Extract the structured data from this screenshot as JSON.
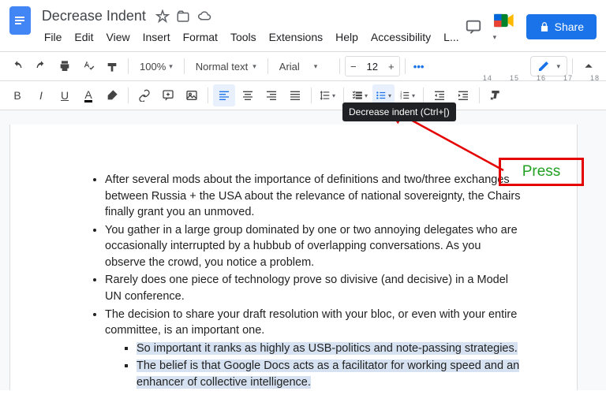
{
  "doc_title": "Decrease Indent",
  "menus": [
    "File",
    "Edit",
    "View",
    "Insert",
    "Format",
    "Tools",
    "Extensions",
    "Help",
    "Accessibility",
    "L..."
  ],
  "share_label": "Share",
  "toolbar": {
    "zoom": "100%",
    "style": "Normal text",
    "font": "Arial",
    "font_size": "12"
  },
  "tooltip": "Decrease indent (Ctrl+[)",
  "ruler_marks": [
    "14",
    "15",
    "16",
    "17",
    "18"
  ],
  "annotation_label": "Press",
  "bullets": [
    "After several mods about the importance of definitions and two/three exchanges between Russia + the USA about the relevance of national sovereignty, the Chairs finally grant you an unmoved.",
    "You gather in a large group dominated by one or two annoying delegates who are occasionally interrupted by a hubbub of overlapping conversations. As you observe the crowd, you notice a problem.",
    "Rarely does one piece of technology prove so divisive (and decisive) in a Model UN conference.",
    "The decision to share your draft resolution with your bloc, or even with your entire committee, is an important one."
  ],
  "sub_bullets": [
    "So important it ranks as highly as USB-politics and note-passing strategies.",
    "The belief is that Google Docs acts as a facilitator for working speed and an enhancer of collective intelligence."
  ]
}
